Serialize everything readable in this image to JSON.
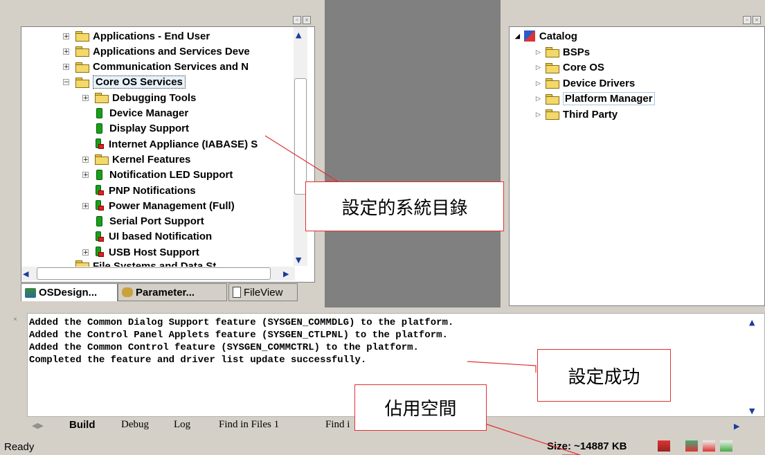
{
  "left_tree": {
    "items": [
      {
        "expander": "+",
        "icon": "folder",
        "label": "Applications - End User"
      },
      {
        "expander": "+",
        "icon": "folder",
        "label": "Applications and Services Deve"
      },
      {
        "expander": "+",
        "icon": "folder",
        "label": "Communication Services and N"
      },
      {
        "expander": "−",
        "icon": "folder-open",
        "label": "Core OS Services",
        "selected": true
      },
      {
        "expander": "+",
        "icon": "folder",
        "label": "Debugging Tools"
      },
      {
        "expander": "",
        "icon": "green",
        "label": "Device Manager"
      },
      {
        "expander": "",
        "icon": "green",
        "label": "Display Support"
      },
      {
        "expander": "",
        "icon": "green-red",
        "label": "Internet Appliance (IABASE) S"
      },
      {
        "expander": "+",
        "icon": "folder",
        "label": "Kernel Features"
      },
      {
        "expander": "+",
        "icon": "green",
        "label": "Notification LED Support"
      },
      {
        "expander": "",
        "icon": "green-red",
        "label": "PNP Notifications"
      },
      {
        "expander": "+",
        "icon": "green-red",
        "label": "Power Management (Full)"
      },
      {
        "expander": "",
        "icon": "green",
        "label": "Serial Port Support"
      },
      {
        "expander": "",
        "icon": "green-red",
        "label": "UI based Notification"
      },
      {
        "expander": "+",
        "icon": "green-red",
        "label": "USB Host Support"
      }
    ],
    "partial_label": "File Systems and Data St"
  },
  "left_tabs": [
    "OSDesign...",
    "Parameter...",
    "FileView"
  ],
  "catalog": {
    "root": "Catalog",
    "items": [
      "BSPs",
      "Core OS",
      "Device Drivers",
      "Platform Manager",
      "Third Party"
    ]
  },
  "output": {
    "lines": [
      "Added the Common Dialog Support feature (SYSGEN_COMMDLG) to the platform.",
      "Added the Control Panel Applets feature (SYSGEN_CTLPNL) to the platform.",
      "Added the Common Control feature (SYSGEN_COMMCTRL) to the platform.",
      "Completed the feature and driver list update successfully."
    ]
  },
  "output_tabs": [
    "Build",
    "Debug",
    "Log",
    "Find in Files 1",
    "Find i"
  ],
  "status": {
    "text": "Ready",
    "size": "Size: ~14887 KB"
  },
  "callouts": {
    "system_dir": "設定的系統目錄",
    "success": "設定成功",
    "space": "佔用空間"
  },
  "colors": {
    "callout_border": "#e03030",
    "arrow_line": "#e03030",
    "separator_gray": "#808080"
  }
}
